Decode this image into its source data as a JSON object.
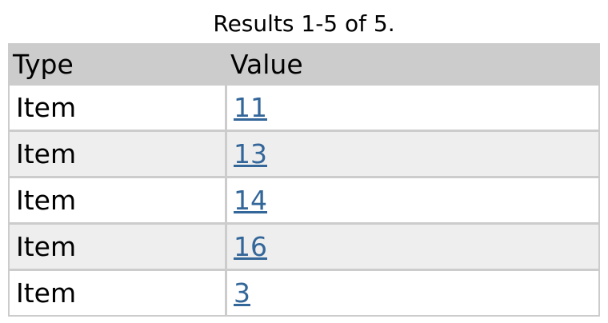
{
  "caption": "Results 1-5 of 5.",
  "table": {
    "columns": [
      "Type",
      "Value"
    ],
    "rows": [
      {
        "type": "Item",
        "value": "11"
      },
      {
        "type": "Item",
        "value": "13"
      },
      {
        "type": "Item",
        "value": "14"
      },
      {
        "type": "Item",
        "value": "16"
      },
      {
        "type": "Item",
        "value": "3"
      }
    ]
  },
  "colors": {
    "header_bg": "#cccccc",
    "row_alt_bg": "#eeeeee",
    "link": "#336699"
  }
}
